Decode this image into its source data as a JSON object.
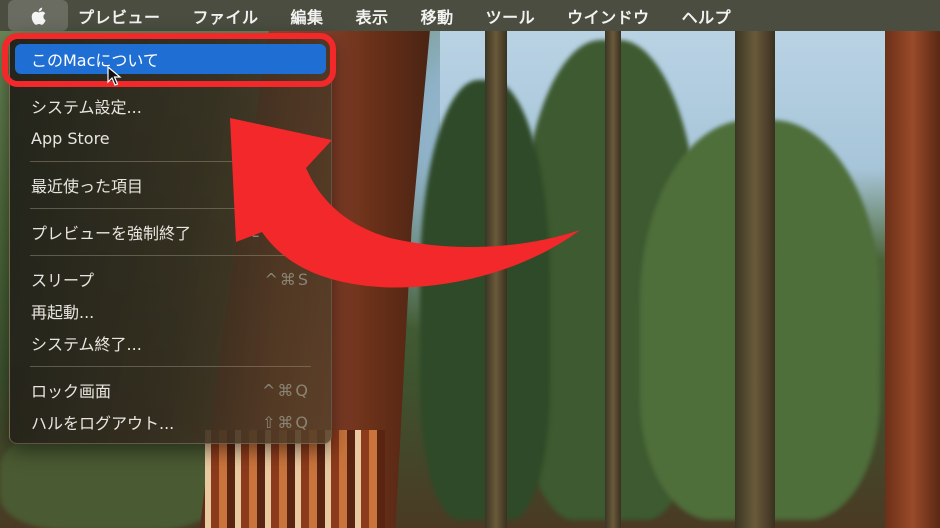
{
  "menubar": {
    "apple_icon": "apple-logo-icon",
    "app_name": "プレビュー",
    "items": [
      "ファイル",
      "編集",
      "表示",
      "移動",
      "ツール",
      "ウインドウ",
      "ヘルプ"
    ]
  },
  "apple_menu": {
    "items": [
      {
        "label": "このMacについて",
        "shortcut": "",
        "highlighted": true
      },
      {
        "label": "システム設定...",
        "shortcut": ""
      },
      {
        "label": "App Store",
        "shortcut": ""
      },
      {
        "label": "最近使った項目",
        "shortcut": ""
      },
      {
        "label": "プレビューを強制終了",
        "shortcut": "⌥⇧⌘⎋"
      },
      {
        "label": "スリープ",
        "shortcut": "^⌘S"
      },
      {
        "label": "再起動...",
        "shortcut": ""
      },
      {
        "label": "システム終了...",
        "shortcut": ""
      },
      {
        "label": "ロック画面",
        "shortcut": "^⌘Q"
      },
      {
        "label": "ハルをログアウト...",
        "shortcut": "⇧⌘Q"
      }
    ]
  },
  "annotations": {
    "highlight_ring_color": "#f2282b",
    "arrow_color": "#f2282b",
    "selection_color": "#1f6ed4"
  }
}
